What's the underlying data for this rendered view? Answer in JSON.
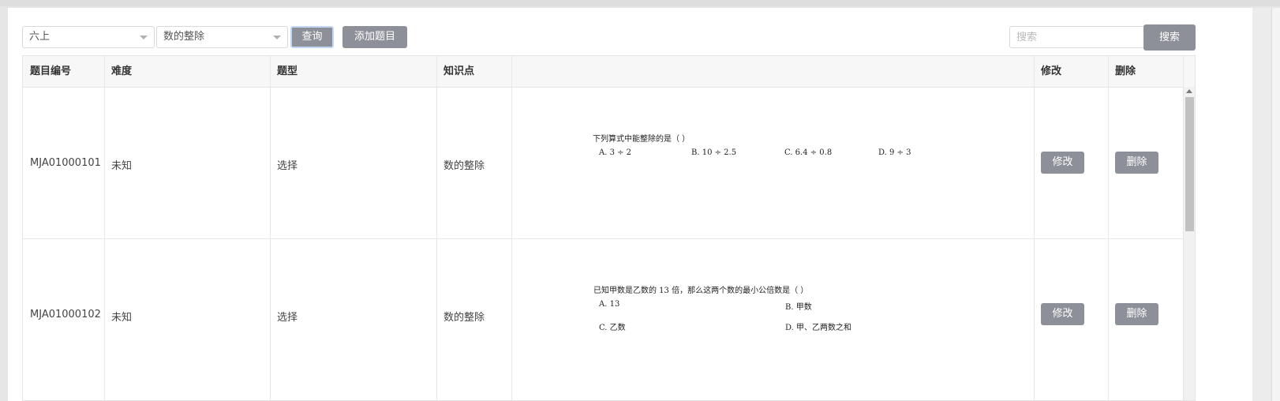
{
  "toolbar": {
    "grade_select": "六上",
    "topic_select": "数的整除",
    "query_label": "查询",
    "add_label": "添加题目",
    "search_placeholder": "搜索",
    "search_button": "搜索"
  },
  "table": {
    "headers": [
      "题目编号",
      "难度",
      "题型",
      "知识点",
      "",
      "修改",
      "删除"
    ],
    "rows": [
      {
        "id": "MJA01000101",
        "difficulty": "未知",
        "type": "选择",
        "topic": "数的整除",
        "question": {
          "stem": "下列算式中能整除的是（          ）",
          "a": "A. 3 ÷ 2",
          "b": "B. 10 ÷ 2.5",
          "c": "C. 6.4 ÷ 0.8",
          "d": "D. 9 ÷ 3"
        },
        "edit_label": "修改",
        "delete_label": "删除"
      },
      {
        "id": "MJA01000102",
        "difficulty": "未知",
        "type": "选择",
        "topic": "数的整除",
        "question": {
          "stem": "已知甲数是乙数的 13 倍，那么这两个数的最小公倍数是（          ）",
          "a": "A. 13",
          "b": "B. 甲数",
          "c": "C. 乙数",
          "d": "D. 甲、乙两数之和"
        },
        "edit_label": "修改",
        "delete_label": "删除"
      }
    ]
  },
  "colors": {
    "button_bg": "#8e9099",
    "header_bg": "#f7f7f7",
    "border": "#e4e4e4"
  }
}
